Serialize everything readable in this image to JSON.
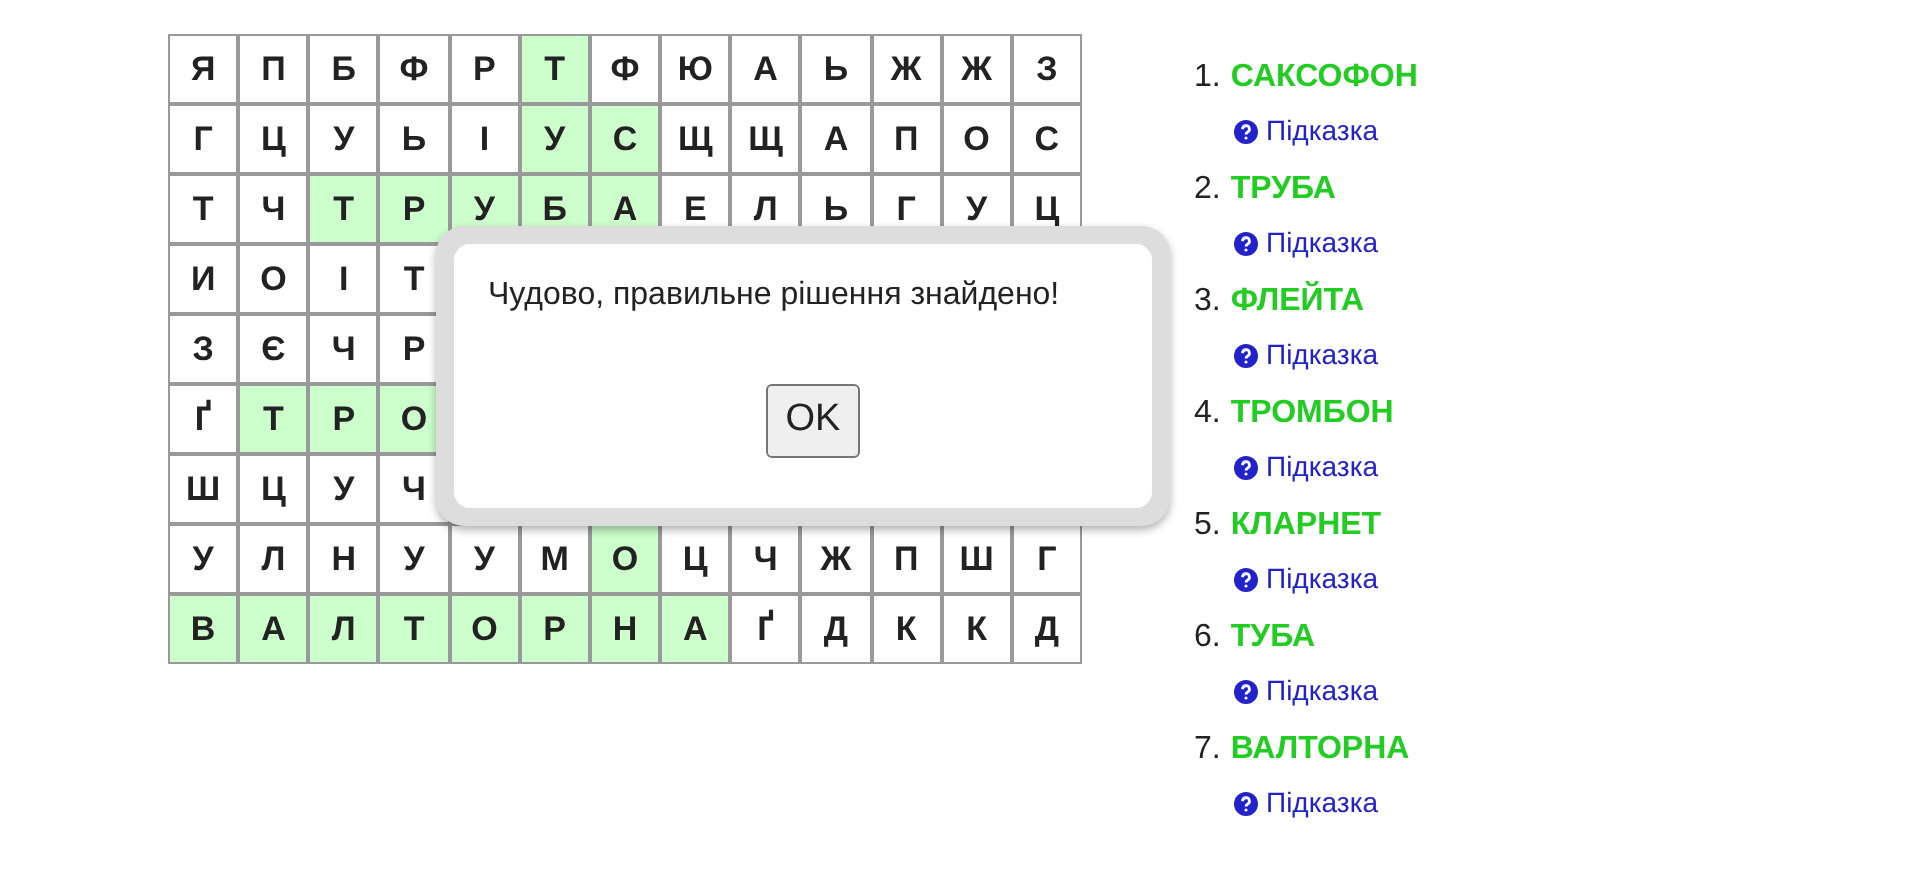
{
  "grid": {
    "rows": [
      [
        {
          "letter": "Я",
          "selected": false
        },
        {
          "letter": "П",
          "selected": false
        },
        {
          "letter": "Б",
          "selected": false
        },
        {
          "letter": "Ф",
          "selected": false
        },
        {
          "letter": "Р",
          "selected": false
        },
        {
          "letter": "Т",
          "selected": true
        },
        {
          "letter": "Ф",
          "selected": false
        },
        {
          "letter": "Ю",
          "selected": false
        },
        {
          "letter": "А",
          "selected": false
        },
        {
          "letter": "Ь",
          "selected": false
        },
        {
          "letter": "Ж",
          "selected": false
        },
        {
          "letter": "Ж",
          "selected": false
        },
        {
          "letter": "З",
          "selected": false
        }
      ],
      [
        {
          "letter": "Г",
          "selected": false
        },
        {
          "letter": "Ц",
          "selected": false
        },
        {
          "letter": "У",
          "selected": false
        },
        {
          "letter": "Ь",
          "selected": false
        },
        {
          "letter": "І",
          "selected": false
        },
        {
          "letter": "У",
          "selected": true
        },
        {
          "letter": "С",
          "selected": true
        },
        {
          "letter": "Щ",
          "selected": false
        },
        {
          "letter": "Щ",
          "selected": false
        },
        {
          "letter": "А",
          "selected": false
        },
        {
          "letter": "П",
          "selected": false
        },
        {
          "letter": "О",
          "selected": false
        },
        {
          "letter": "С",
          "selected": false
        }
      ],
      [
        {
          "letter": "Т",
          "selected": false
        },
        {
          "letter": "Ч",
          "selected": false
        },
        {
          "letter": "Т",
          "selected": true
        },
        {
          "letter": "Р",
          "selected": true
        },
        {
          "letter": "У",
          "selected": true
        },
        {
          "letter": "Б",
          "selected": true
        },
        {
          "letter": "А",
          "selected": true
        },
        {
          "letter": "Е",
          "selected": false
        },
        {
          "letter": "Л",
          "selected": false
        },
        {
          "letter": "Ь",
          "selected": false
        },
        {
          "letter": "Г",
          "selected": false
        },
        {
          "letter": "У",
          "selected": false
        },
        {
          "letter": "Ц",
          "selected": false
        }
      ],
      [
        {
          "letter": "И",
          "selected": false
        },
        {
          "letter": "О",
          "selected": false
        },
        {
          "letter": "І",
          "selected": false
        },
        {
          "letter": "Т",
          "selected": false
        }
      ],
      [
        {
          "letter": "З",
          "selected": false
        },
        {
          "letter": "Є",
          "selected": false
        },
        {
          "letter": "Ч",
          "selected": false
        },
        {
          "letter": "Р",
          "selected": false
        }
      ],
      [
        {
          "letter": "Ґ",
          "selected": false
        },
        {
          "letter": "Т",
          "selected": true
        },
        {
          "letter": "Р",
          "selected": true
        },
        {
          "letter": "О",
          "selected": true
        }
      ],
      [
        {
          "letter": "Ш",
          "selected": false
        },
        {
          "letter": "Ц",
          "selected": false
        },
        {
          "letter": "У",
          "selected": false
        },
        {
          "letter": "Ч",
          "selected": false
        }
      ],
      [
        {
          "letter": "У",
          "selected": false
        },
        {
          "letter": "Л",
          "selected": false
        },
        {
          "letter": "Н",
          "selected": false
        },
        {
          "letter": "У",
          "selected": false
        },
        {
          "letter": "У",
          "selected": false
        },
        {
          "letter": "М",
          "selected": false
        },
        {
          "letter": "О",
          "selected": true
        },
        {
          "letter": "Ц",
          "selected": false
        },
        {
          "letter": "Ч",
          "selected": false
        },
        {
          "letter": "Ж",
          "selected": false
        },
        {
          "letter": "П",
          "selected": false
        },
        {
          "letter": "Ш",
          "selected": false
        },
        {
          "letter": "Г",
          "selected": false
        }
      ],
      [
        {
          "letter": "В",
          "selected": true
        },
        {
          "letter": "А",
          "selected": true
        },
        {
          "letter": "Л",
          "selected": true
        },
        {
          "letter": "Т",
          "selected": true
        },
        {
          "letter": "О",
          "selected": true
        },
        {
          "letter": "Р",
          "selected": true
        },
        {
          "letter": "Н",
          "selected": true
        },
        {
          "letter": "А",
          "selected": true
        },
        {
          "letter": "Ґ",
          "selected": false
        },
        {
          "letter": "Д",
          "selected": false
        },
        {
          "letter": "К",
          "selected": false
        },
        {
          "letter": "К",
          "selected": false
        },
        {
          "letter": "Д",
          "selected": false
        }
      ]
    ]
  },
  "dialog": {
    "message": "Чудово, правильне рішення знайдено!",
    "button": "OK"
  },
  "words": [
    {
      "number": "1.",
      "word": "САКСОФОН",
      "found": true,
      "hint": "Підказка"
    },
    {
      "number": "2.",
      "word": "ТРУБА",
      "found": true,
      "hint": "Підказка"
    },
    {
      "number": "3.",
      "word": "ФЛЕЙТА",
      "found": true,
      "hint": "Підказка"
    },
    {
      "number": "4.",
      "word": "ТРОМБОН",
      "found": true,
      "hint": "Підказка"
    },
    {
      "number": "5.",
      "word": "КЛАРНЕТ",
      "found": true,
      "hint": "Підказка"
    },
    {
      "number": "6.",
      "word": "ТУБА",
      "found": true,
      "hint": "Підказка"
    },
    {
      "number": "7.",
      "word": "ВАЛТОРНА",
      "found": true,
      "hint": "Підказка"
    }
  ]
}
